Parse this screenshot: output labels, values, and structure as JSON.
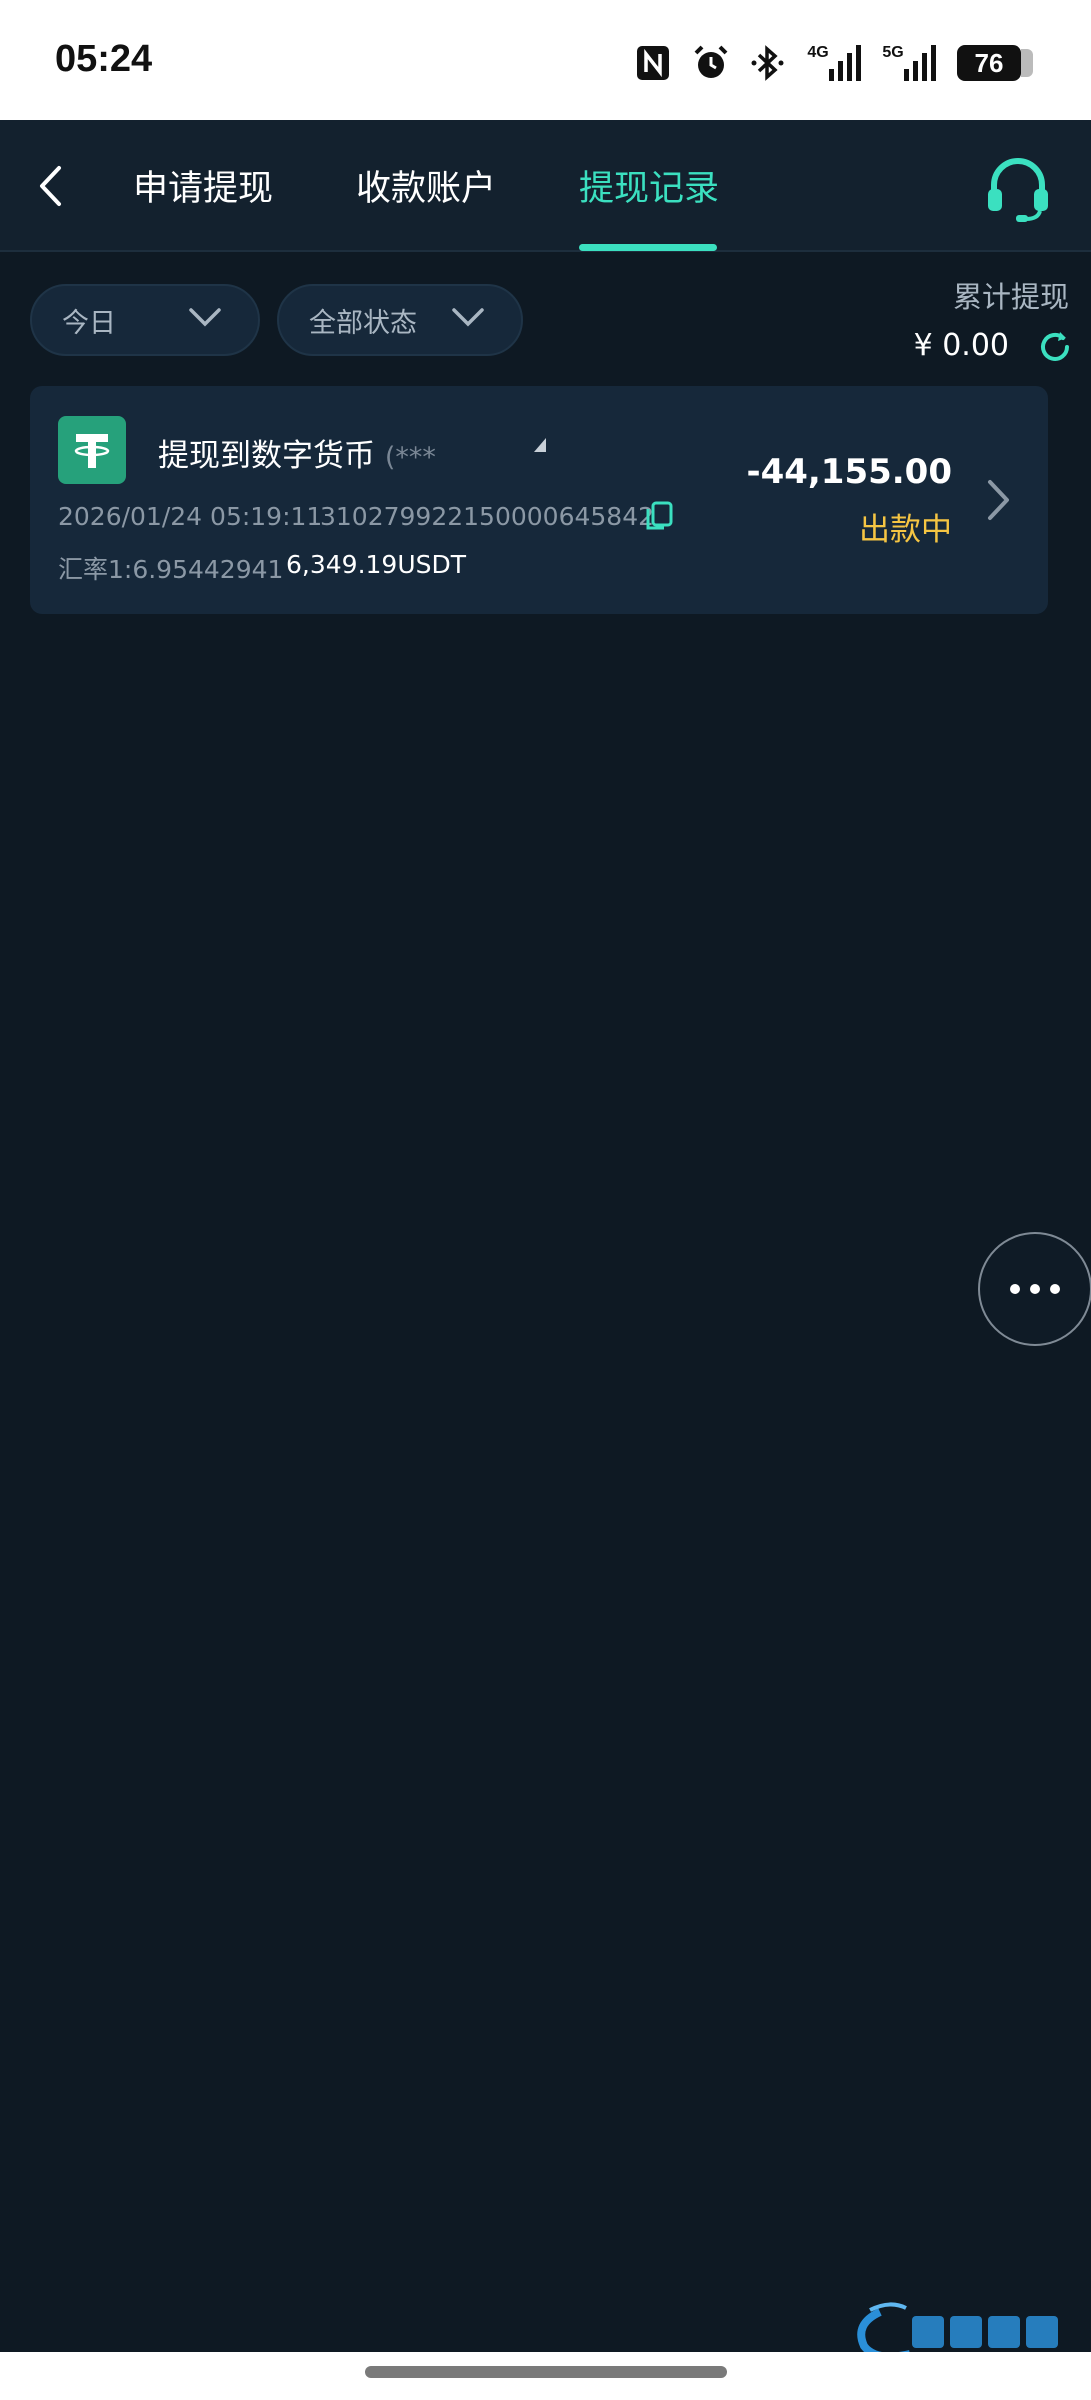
{
  "status_bar": {
    "time": "05:24",
    "net_4g": "4G",
    "net_5g": "5G",
    "battery": "76",
    "icons": [
      "nfc-icon",
      "alarm-icon",
      "bluetooth-icon",
      "signal-icon",
      "signal-icon",
      "battery-icon"
    ]
  },
  "header": {
    "tabs": [
      {
        "label": "申请提现",
        "active": false
      },
      {
        "label": "收款账户",
        "active": false
      },
      {
        "label": "提现记录",
        "active": true
      }
    ],
    "accent_color": "#3be0c0"
  },
  "filters": {
    "date_label": "今日",
    "status_label": "全部状态"
  },
  "summary": {
    "total_label": "累计提现",
    "total_amount": "¥ 0.00"
  },
  "records": [
    {
      "title": "提现到数字货币",
      "masked_account": "(***",
      "datetime": "2026/01/24 05:19:11",
      "order_no": "310279922150000645842",
      "rate": "汇率1:6.95442941",
      "usdt": "6,349.19USDT",
      "amount": "-44,155.00",
      "status": "出款中",
      "status_color": "#f5c543"
    }
  ]
}
